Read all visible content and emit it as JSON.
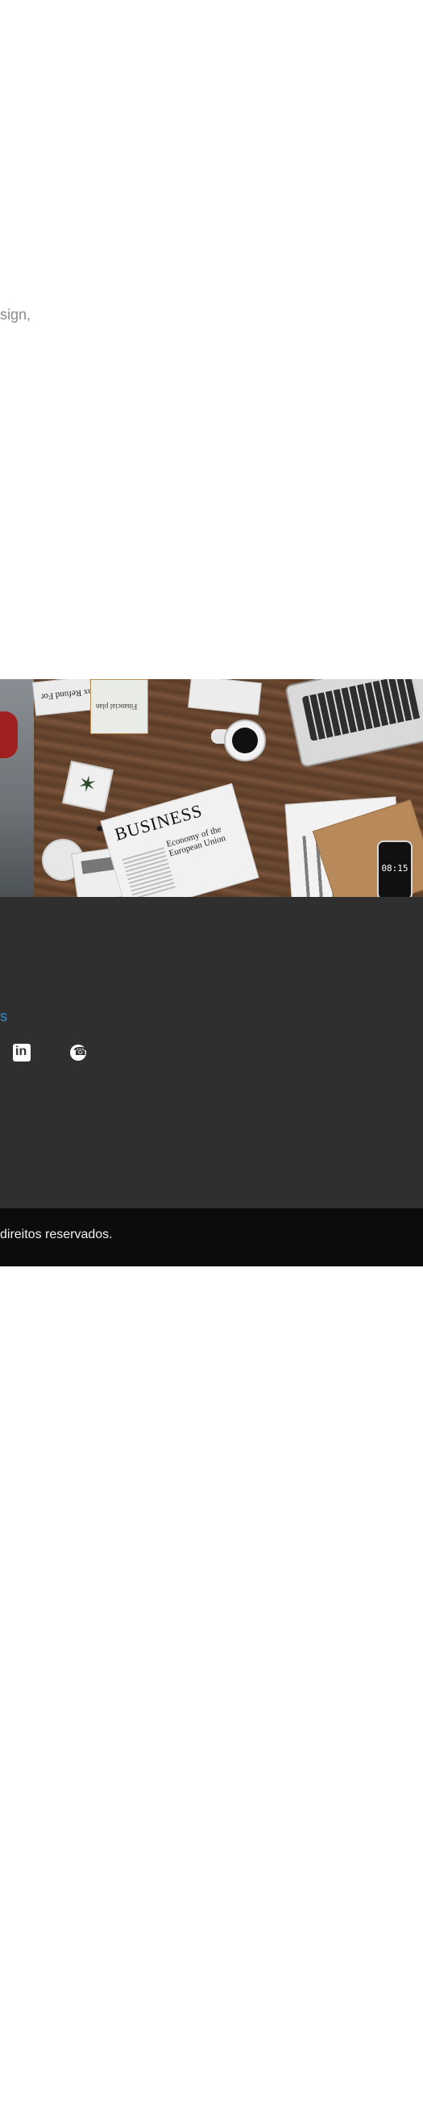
{
  "top": {
    "text": "sign,"
  },
  "image": {
    "tax_form_label": "Tax Refund For",
    "clipboard_label": "Financial plan",
    "newspaper_headline": "BUSINESS",
    "newspaper_subhead": "Economy of the European Union",
    "phone_time": "08:15"
  },
  "footer": {
    "link_fragment": "s",
    "social": [
      {
        "name": "LinkedIn",
        "icon": "linkedin-icon"
      },
      {
        "name": "WhatsApp",
        "icon": "whatsapp-icon"
      }
    ]
  },
  "bottom_bar": {
    "copyright": "direitos reservados."
  },
  "colors": {
    "footer_background": "#2f2f2f",
    "bottom_bar_background": "#0c0c0c",
    "link_accent": "#2f8fd1"
  }
}
